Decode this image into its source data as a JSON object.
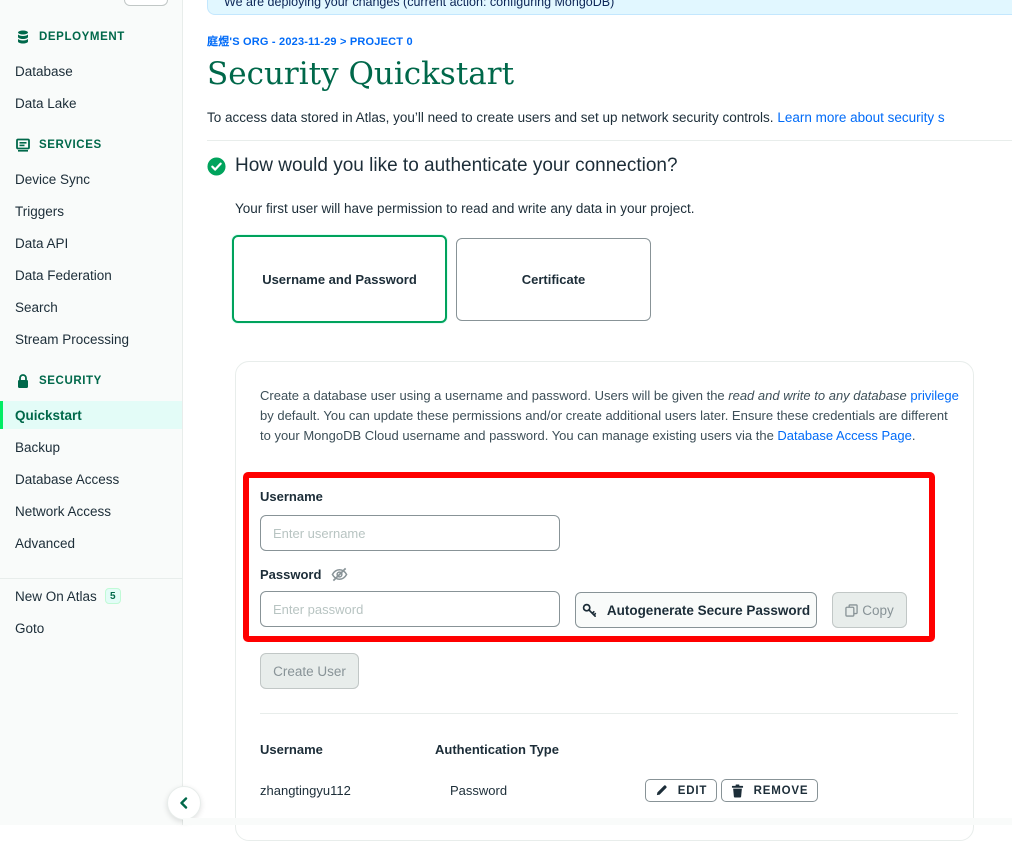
{
  "banner": {
    "text": "We are deploying your changes (current action: configuring MongoDB)"
  },
  "sidebar": {
    "sections": {
      "deployment": "DEPLOYMENT",
      "services": "SERVICES",
      "security": "SECURITY"
    },
    "deployment_items": [
      "Database",
      "Data Lake"
    ],
    "services_items": [
      "Device Sync",
      "Triggers",
      "Data API",
      "Data Federation",
      "Search",
      "Stream Processing"
    ],
    "security_items": [
      "Quickstart",
      "Backup",
      "Database Access",
      "Network Access",
      "Advanced"
    ],
    "active_item": "Quickstart",
    "new_on_atlas": {
      "label": "New On Atlas",
      "count": "5"
    },
    "goto": "Goto"
  },
  "header": {
    "breadcrumb": "庭煜'S ORG - 2023-11-29 > PROJECT 0",
    "title": "Security Quickstart",
    "intro_text": "To access data stored in Atlas, you’ll need to create users and set up network security controls.",
    "intro_link": "Learn more about security s"
  },
  "auth": {
    "question": "How would you like to authenticate your connection?",
    "permission_text": "Your first user will have permission to read and write any data in your project.",
    "options": [
      "Username and Password",
      "Certificate"
    ],
    "selected": "Username and Password"
  },
  "form": {
    "desc_part1": "Create a database user using a username and password. Users will be given the ",
    "desc_italic": "read and write to any database",
    "desc_link1": "privilege",
    "desc_part2": " by default. You can update these permissions and/or create additional users later. Ensure these credentials are different to your MongoDB Cloud username and password. You can manage existing users via the ",
    "desc_link2": "Database Access Page",
    "desc_end": ".",
    "username_label": "Username",
    "username_placeholder": "Enter username",
    "username_value": "",
    "password_label": "Password",
    "password_placeholder": "Enter password",
    "password_value": "",
    "autogen_label": "Autogenerate Secure Password",
    "copy_label": "Copy",
    "create_label": "Create User"
  },
  "users_table": {
    "headers": [
      "Username",
      "Authentication Type"
    ],
    "rows": [
      {
        "username": "zhangtingyu112",
        "auth_type": "Password",
        "edit": "EDIT",
        "remove": "REMOVE"
      }
    ]
  },
  "colors": {
    "brand_green": "#00684a",
    "accent_green": "#00a35c",
    "link_blue": "#016bf8",
    "highlight_red": "#ff0000"
  }
}
